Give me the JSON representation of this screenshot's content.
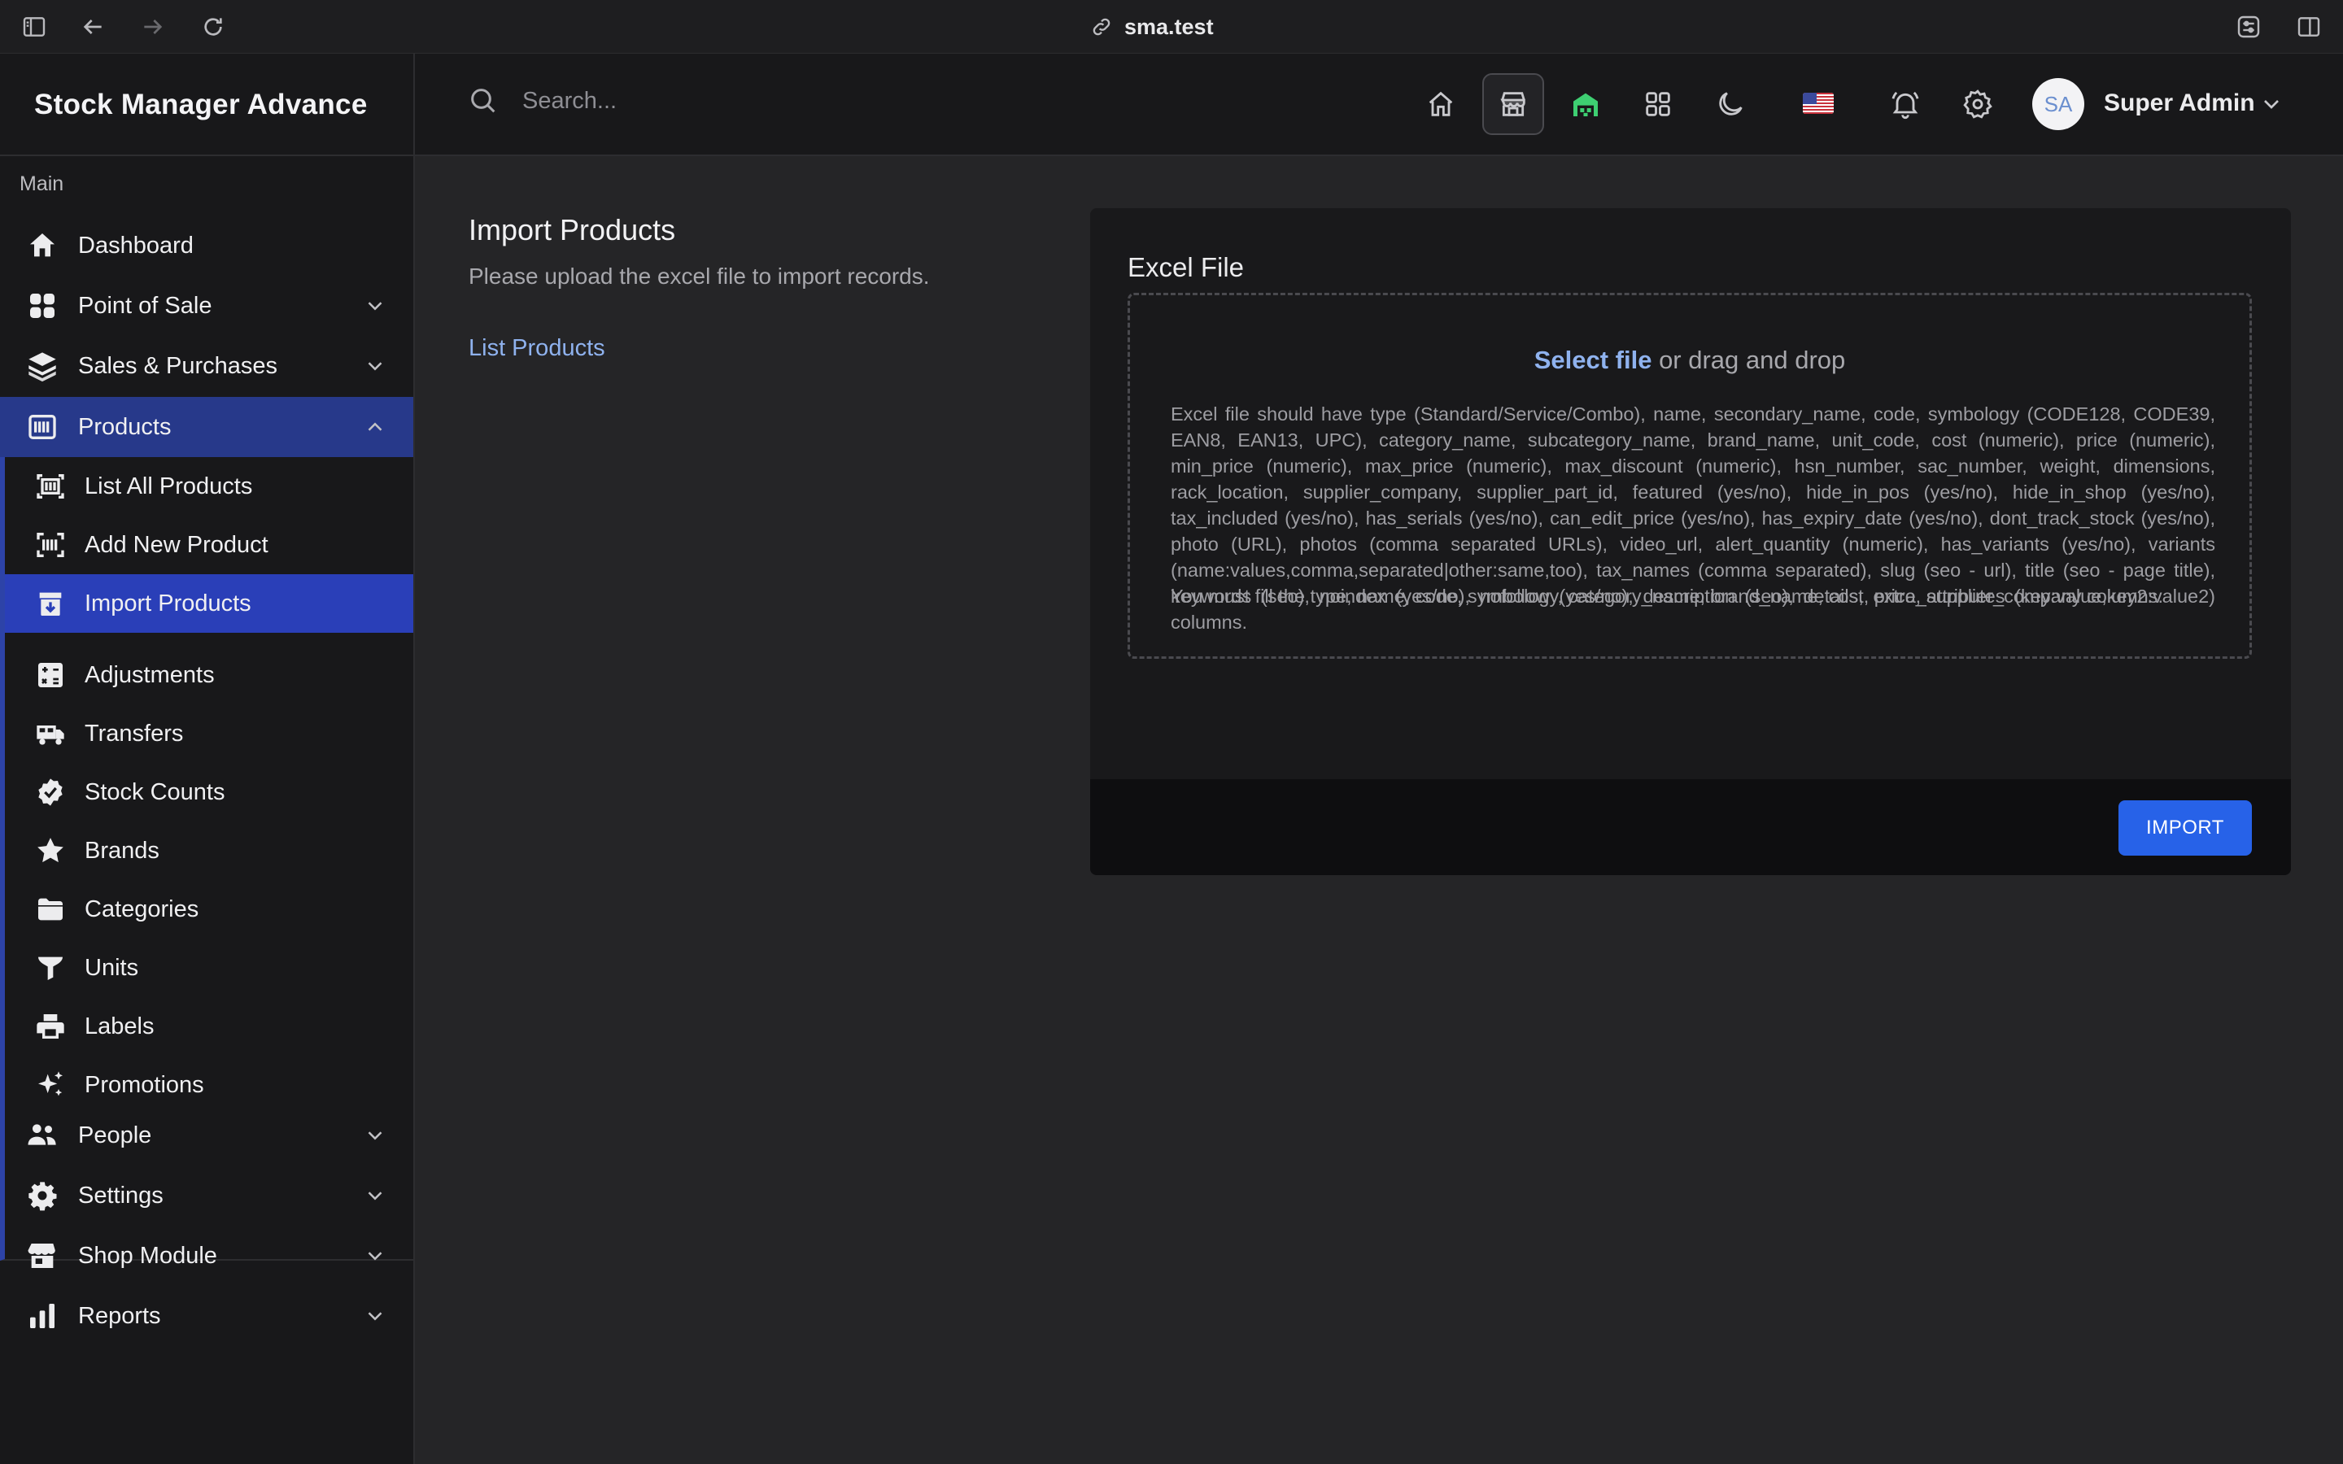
{
  "browser": {
    "url": "sma.test"
  },
  "app": {
    "brand": "Stock Manager Advance"
  },
  "search": {
    "placeholder": "Search..."
  },
  "user": {
    "initials": "SA",
    "name": "Super Admin"
  },
  "sidebar": {
    "section": "Main",
    "items": [
      {
        "label": "Dashboard",
        "icon": "home-icon"
      },
      {
        "label": "Point of Sale",
        "icon": "grid-icon"
      },
      {
        "label": "Sales & Purchases",
        "icon": "layers-icon"
      },
      {
        "label": "Products",
        "icon": "barcode-icon"
      }
    ],
    "product_sub": [
      {
        "label": "List All Products",
        "icon": "barcode-box-icon"
      },
      {
        "label": "Add New Product",
        "icon": "barcode-scan-icon"
      },
      {
        "label": "Import Products",
        "icon": "import-icon"
      },
      {
        "label": "Adjustments",
        "icon": "calculator-icon"
      },
      {
        "label": "Transfers",
        "icon": "truck-icon"
      },
      {
        "label": "Stock Counts",
        "icon": "check-badge-icon"
      },
      {
        "label": "Brands",
        "icon": "star-icon"
      },
      {
        "label": "Categories",
        "icon": "folder-icon"
      },
      {
        "label": "Units",
        "icon": "funnel-icon"
      },
      {
        "label": "Labels",
        "icon": "printer-icon"
      },
      {
        "label": "Promotions",
        "icon": "sparkles-icon"
      }
    ],
    "bottom": [
      {
        "label": "People",
        "icon": "users-icon"
      },
      {
        "label": "Settings",
        "icon": "gear-icon"
      },
      {
        "label": "Shop Module",
        "icon": "store-icon"
      },
      {
        "label": "Reports",
        "icon": "chart-icon"
      }
    ]
  },
  "main": {
    "title": "Import Products",
    "description": "Please upload the excel file to import records.",
    "list_link": "List Products"
  },
  "card": {
    "title": "Excel File",
    "select_file": "Select file",
    "drag_text": " or drag and drop",
    "instructions": "Excel file should have type (Standard/Service/Combo), name, secondary_name, code, symbology (CODE128, CODE39, EAN8, EAN13, UPC), category_name, subcategory_name, brand_name, unit_code, cost (numeric), price (numeric), min_price (numeric), max_price (numeric), max_discount (numeric), hsn_number, sac_number, weight, dimensions, rack_location, supplier_company, supplier_part_id, featured (yes/no), hide_in_pos (yes/no), hide_in_shop (yes/no), tax_included (yes/no), has_serials (yes/no), can_edit_price (yes/no), has_expiry_date (yes/no), dont_track_stock (yes/no), photo (URL), photos (comma separated URLs), video_url, alert_quantity (numeric), has_variants (yes/no), variants (name:values,comma,separated|other:same,too), tax_names (comma separated), slug (seo - url), title (seo - page title), keywords (seo), noindex (yes/no), nofollow (yes/no), description (seo), details, extra_attributes (key:value,key2:value2) columns.",
    "required": "You must fill the type, name, code, symbology, category_name, brand_name, cost, price, supplier_company columns.",
    "import_label": "IMPORT"
  },
  "colors": {
    "accent": "#2762e8",
    "sidebar_active": "#2a3fb8",
    "link": "#8fb2ee"
  }
}
